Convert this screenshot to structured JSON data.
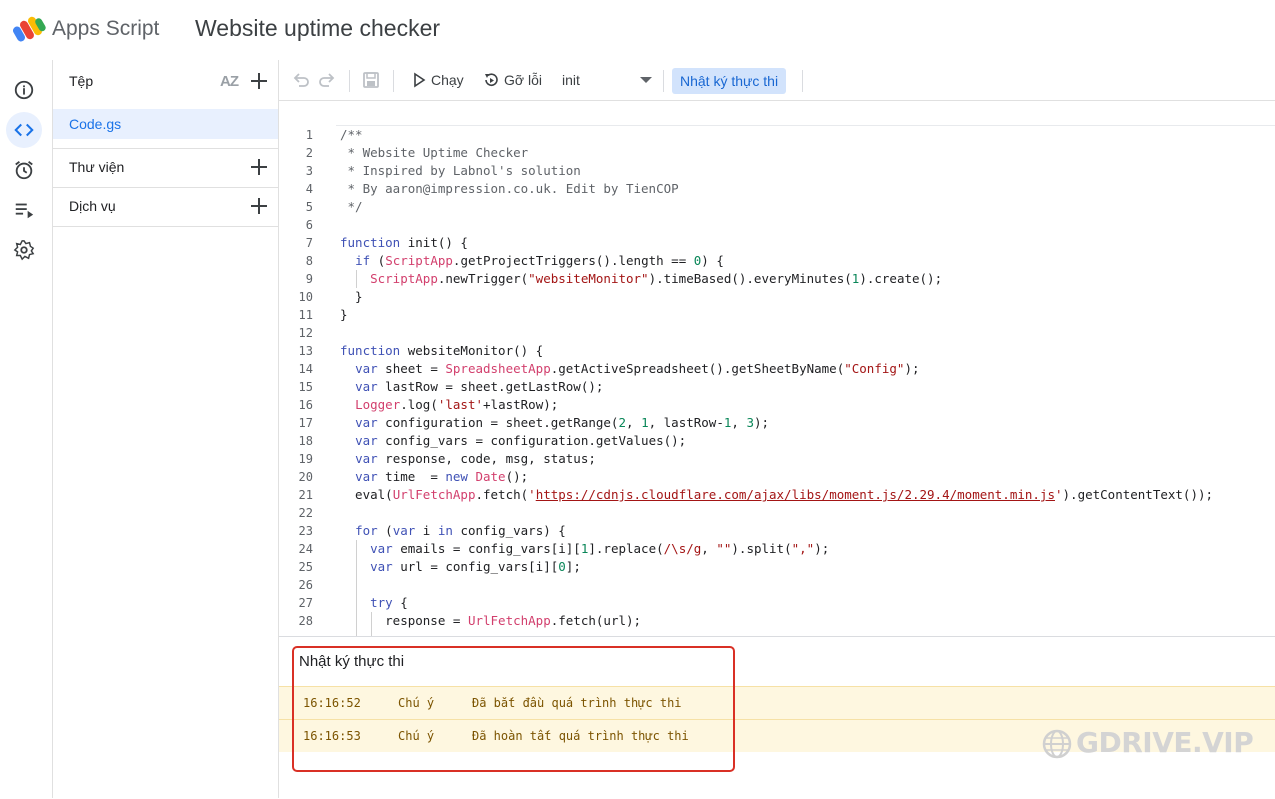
{
  "header": {
    "app_name": "Apps Script",
    "project_title": "Website uptime checker"
  },
  "rail": {
    "items": [
      "overview-icon",
      "editor-icon",
      "triggers-icon",
      "executions-icon",
      "settings-icon"
    ]
  },
  "files_panel": {
    "files_label": "Tệp",
    "sort_label": "AZ",
    "files": [
      "Code.gs"
    ],
    "libraries_label": "Thư viện",
    "services_label": "Dịch vụ"
  },
  "toolbar": {
    "run_label": "Chạy",
    "debug_label": "Gỡ lỗi",
    "function_selected": "init",
    "execution_log_label": "Nhật ký thực thi"
  },
  "code_lines": [
    "1",
    "2",
    "3",
    "4",
    "5",
    "6",
    "7",
    "8",
    "9",
    "10",
    "11",
    "12",
    "13",
    "14",
    "15",
    "16",
    "17",
    "18",
    "19",
    "20",
    "21",
    "22",
    "23",
    "24",
    "25",
    "26",
    "27",
    "28"
  ],
  "execution_log": {
    "title": "Nhật ký thực thi",
    "rows": [
      {
        "time": "16:16:52",
        "level": "Chú ý",
        "message": "Đã bắt đầu quá trình thực thi"
      },
      {
        "time": "16:16:53",
        "level": "Chú ý",
        "message": "Đã hoàn tất quá trình thực thi"
      }
    ]
  },
  "watermark": "GDRIVE.VIP",
  "colors": {
    "accent": "#1a73e8",
    "active_bg": "#e8f0fe",
    "log_bg": "#fef7e0",
    "highlight": "#d93025"
  }
}
